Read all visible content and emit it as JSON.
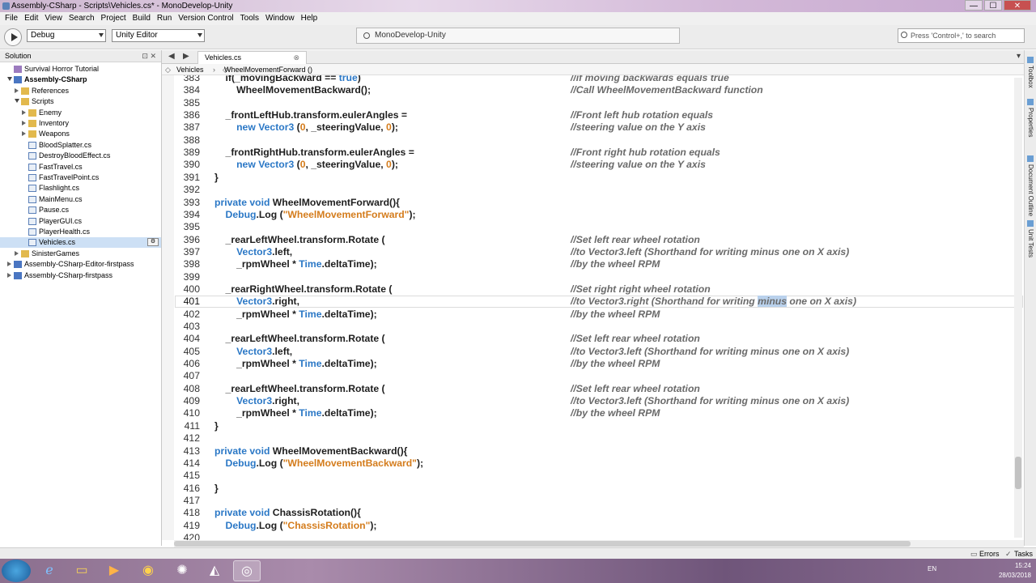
{
  "window": {
    "title": "Assembly-CSharp - Scripts\\Vehicles.cs* - MonoDevelop-Unity",
    "controls": {
      "minimize": "—",
      "maximize": "☐",
      "close": "✕"
    }
  },
  "menu": [
    "File",
    "Edit",
    "View",
    "Search",
    "Project",
    "Build",
    "Run",
    "Version Control",
    "Tools",
    "Window",
    "Help"
  ],
  "toolbar": {
    "config": "Debug",
    "target": "Unity Editor",
    "status": "MonoDevelop-Unity",
    "search_placeholder": "Press 'Control+,' to search"
  },
  "solution_panel": {
    "title": "Solution",
    "controls": "⊡ ✕",
    "tree": [
      {
        "label": "Survival Horror Tutorial",
        "icon": "solution-icon",
        "depth": 0,
        "toggle": "none"
      },
      {
        "label": "Assembly-CSharp",
        "icon": "project-icon",
        "depth": 0,
        "toggle": "open",
        "bold": true
      },
      {
        "label": "References",
        "icon": "folder-icon",
        "depth": 1,
        "toggle": "closed"
      },
      {
        "label": "Scripts",
        "icon": "folder-icon",
        "depth": 1,
        "toggle": "open"
      },
      {
        "label": "Enemy",
        "icon": "folder-icon",
        "depth": 2,
        "toggle": "closed"
      },
      {
        "label": "Inventory",
        "icon": "folder-icon",
        "depth": 2,
        "toggle": "closed"
      },
      {
        "label": "Weapons",
        "icon": "folder-icon",
        "depth": 2,
        "toggle": "closed"
      },
      {
        "label": "BloodSplatter.cs",
        "icon": "file-icon",
        "depth": 2,
        "toggle": "none"
      },
      {
        "label": "DestroyBloodEffect.cs",
        "icon": "file-icon",
        "depth": 2,
        "toggle": "none"
      },
      {
        "label": "FastTravel.cs",
        "icon": "file-icon",
        "depth": 2,
        "toggle": "none"
      },
      {
        "label": "FastTravelPoint.cs",
        "icon": "file-icon",
        "depth": 2,
        "toggle": "none"
      },
      {
        "label": "Flashlight.cs",
        "icon": "file-icon",
        "depth": 2,
        "toggle": "none"
      },
      {
        "label": "MainMenu.cs",
        "icon": "file-icon",
        "depth": 2,
        "toggle": "none"
      },
      {
        "label": "Pause.cs",
        "icon": "file-icon",
        "depth": 2,
        "toggle": "none"
      },
      {
        "label": "PlayerGUI.cs",
        "icon": "file-icon",
        "depth": 2,
        "toggle": "none"
      },
      {
        "label": "PlayerHealth.cs",
        "icon": "file-icon",
        "depth": 2,
        "toggle": "none"
      },
      {
        "label": "Vehicles.cs",
        "icon": "file-icon",
        "depth": 2,
        "toggle": "none",
        "selected": true
      },
      {
        "label": "SinisterGames",
        "icon": "folder-icon",
        "depth": 1,
        "toggle": "closed"
      },
      {
        "label": "Assembly-CSharp-Editor-firstpass",
        "icon": "project-icon",
        "depth": 0,
        "toggle": "closed"
      },
      {
        "label": "Assembly-CSharp-firstpass",
        "icon": "project-icon",
        "depth": 0,
        "toggle": "closed"
      }
    ]
  },
  "editor": {
    "tab": "Vehicles.cs",
    "tab_close": "⊗",
    "breadcrumb": [
      "Vehicles",
      "WheelMovementForward ()"
    ],
    "current_line": 401,
    "lines": [
      {
        "n": "383",
        "code": "    if(_movingBackward == true)",
        "cmt": "//if moving backwards equals true"
      },
      {
        "n": "384",
        "code": "        WheelMovementBackward();",
        "cmt": "//Call WheelMovementBackward function"
      },
      {
        "n": "385",
        "code": "",
        "cmt": ""
      },
      {
        "n": "386",
        "code": "    _frontLeftHub.transform.eulerAngles =",
        "cmt": "//Front left hub rotation equals"
      },
      {
        "n": "387",
        "code": "        new Vector3 (0, _steeringValue, 0);",
        "cmt": "//steering value on the Y axis"
      },
      {
        "n": "388",
        "code": "",
        "cmt": ""
      },
      {
        "n": "389",
        "code": "    _frontRightHub.transform.eulerAngles =",
        "cmt": "//Front right hub rotation equals"
      },
      {
        "n": "390",
        "code": "        new Vector3 (0, _steeringValue, 0);",
        "cmt": "//steering value on the Y axis"
      },
      {
        "n": "391",
        "code": "}",
        "cmt": ""
      },
      {
        "n": "392",
        "code": "",
        "cmt": ""
      },
      {
        "n": "393",
        "code": "private void WheelMovementForward(){",
        "cmt": ""
      },
      {
        "n": "394",
        "code": "    Debug.Log (\"WheelMovementForward\");",
        "cmt": ""
      },
      {
        "n": "395",
        "code": "",
        "cmt": ""
      },
      {
        "n": "396",
        "code": "    _rearLeftWheel.transform.Rotate (",
        "cmt": "//Set left rear wheel rotation"
      },
      {
        "n": "397",
        "code": "        Vector3.left,",
        "cmt": "//to Vector3.left (Shorthand for writing minus one on X axis)"
      },
      {
        "n": "398",
        "code": "        _rpmWheel * Time.deltaTime);",
        "cmt": "//by the wheel RPM"
      },
      {
        "n": "399",
        "code": "",
        "cmt": ""
      },
      {
        "n": "400",
        "code": "    _rearRightWheel.transform.Rotate (",
        "cmt": "//Set right right wheel rotation"
      },
      {
        "n": "401",
        "code": "        Vector3.right,",
        "cmt": "//to Vector3.right (Shorthand for writing minus one on X axis)"
      },
      {
        "n": "402",
        "code": "        _rpmWheel * Time.deltaTime);",
        "cmt": "//by the wheel RPM"
      },
      {
        "n": "403",
        "code": "",
        "cmt": ""
      },
      {
        "n": "404",
        "code": "    _rearLeftWheel.transform.Rotate (",
        "cmt": "//Set left rear wheel rotation"
      },
      {
        "n": "405",
        "code": "        Vector3.left,",
        "cmt": "//to Vector3.left (Shorthand for writing minus one on X axis)"
      },
      {
        "n": "406",
        "code": "        _rpmWheel * Time.deltaTime);",
        "cmt": "//by the wheel RPM"
      },
      {
        "n": "407",
        "code": "",
        "cmt": ""
      },
      {
        "n": "408",
        "code": "    _rearLeftWheel.transform.Rotate (",
        "cmt": "//Set left rear wheel rotation"
      },
      {
        "n": "409",
        "code": "        Vector3.right,",
        "cmt": "//to Vector3.left (Shorthand for writing minus one on X axis)"
      },
      {
        "n": "410",
        "code": "        _rpmWheel * Time.deltaTime);",
        "cmt": "//by the wheel RPM"
      },
      {
        "n": "411",
        "code": "}",
        "cmt": ""
      },
      {
        "n": "412",
        "code": "",
        "cmt": ""
      },
      {
        "n": "413",
        "code": "private void WheelMovementBackward(){",
        "cmt": ""
      },
      {
        "n": "414",
        "code": "    Debug.Log (\"WheelMovementBackward\");",
        "cmt": ""
      },
      {
        "n": "415",
        "code": "",
        "cmt": ""
      },
      {
        "n": "416",
        "code": "}",
        "cmt": ""
      },
      {
        "n": "417",
        "code": "",
        "cmt": ""
      },
      {
        "n": "418",
        "code": "private void ChassisRotation(){",
        "cmt": ""
      },
      {
        "n": "419",
        "code": "    Debug.Log (\"ChassisRotation\");",
        "cmt": ""
      },
      {
        "n": "420",
        "code": "",
        "cmt": ""
      }
    ],
    "keywords": [
      "private",
      "void",
      "new",
      "true",
      "Vector3",
      "Debug",
      "Time"
    ],
    "selected_word": "minus"
  },
  "right_dock": [
    "Toolbox",
    "Properties",
    "Document Outline",
    "Unit Tests"
  ],
  "statusbar": {
    "errors": "Errors",
    "tasks": "Tasks"
  },
  "taskbar": {
    "apps": [
      "start-orb",
      "internet-explorer",
      "file-explorer",
      "media-player",
      "chrome",
      "unity-hub",
      "unity",
      "monodevelop"
    ],
    "language": "EN",
    "time": "15:24",
    "date": "28/03/2018"
  },
  "colors": {
    "keyword": "#2b78c6",
    "string": "#d47c1c",
    "comment": "#6a6a6a",
    "selection": "#b9d1ec"
  }
}
